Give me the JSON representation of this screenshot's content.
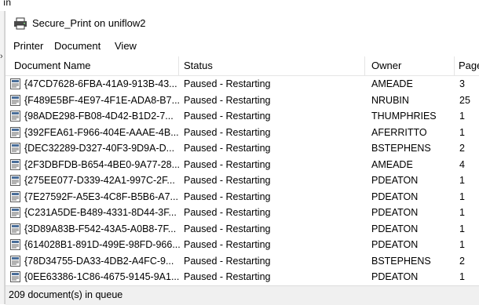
{
  "background": {
    "text": "ın",
    "edge_mark": "›"
  },
  "window": {
    "title": "Secure_Print on uniflow2"
  },
  "menu": [
    "Printer",
    "Document",
    "View"
  ],
  "columns": [
    "Document Name",
    "Status",
    "Owner",
    "Page"
  ],
  "rows": [
    {
      "name": "{47CD7628-6FBA-41A9-913B-43...",
      "status": "Paused - Restarting",
      "owner": "AMEADE",
      "pages": "3"
    },
    {
      "name": "{F489E5BF-4E97-4F1E-ADA8-B7...",
      "status": "Paused - Restarting",
      "owner": "NRUBIN",
      "pages": "25"
    },
    {
      "name": "{98ADE298-FB08-4D42-B1D2-7...",
      "status": "Paused - Restarting",
      "owner": "THUMPHRIES",
      "pages": "1"
    },
    {
      "name": "{392FEA61-F966-404E-AAAE-4B...",
      "status": "Paused - Restarting",
      "owner": "AFERRITTO",
      "pages": "1"
    },
    {
      "name": "{DEC32289-D327-40F3-9D9A-D...",
      "status": "Paused - Restarting",
      "owner": "BSTEPHENS",
      "pages": "2"
    },
    {
      "name": "{2F3DBFDB-B654-4BE0-9A77-28...",
      "status": "Paused - Restarting",
      "owner": "AMEADE",
      "pages": "4"
    },
    {
      "name": "{275EE077-D339-42A1-997C-2F...",
      "status": "Paused - Restarting",
      "owner": "PDEATON",
      "pages": "1"
    },
    {
      "name": "{7E27592F-A5E3-4C8F-B5B6-A7...",
      "status": "Paused - Restarting",
      "owner": "PDEATON",
      "pages": "1"
    },
    {
      "name": "{C231A5DE-B489-4331-8D44-3F...",
      "status": "Paused - Restarting",
      "owner": "PDEATON",
      "pages": "1"
    },
    {
      "name": "{3D89A83B-F542-43A5-A0B8-7F...",
      "status": "Paused - Restarting",
      "owner": "PDEATON",
      "pages": "1"
    },
    {
      "name": "{614028B1-891D-499E-98FD-966...",
      "status": "Paused - Restarting",
      "owner": "PDEATON",
      "pages": "1"
    },
    {
      "name": "{78D34755-DA33-4DB2-A4FC-9...",
      "status": "Paused - Restarting",
      "owner": "BSTEPHENS",
      "pages": "2"
    },
    {
      "name": "{0EE63386-1C86-4675-9145-9A1...",
      "status": "Paused - Restarting",
      "owner": "PDEATON",
      "pages": "1"
    }
  ],
  "statusbar": {
    "text": "209 document(s) in queue"
  }
}
